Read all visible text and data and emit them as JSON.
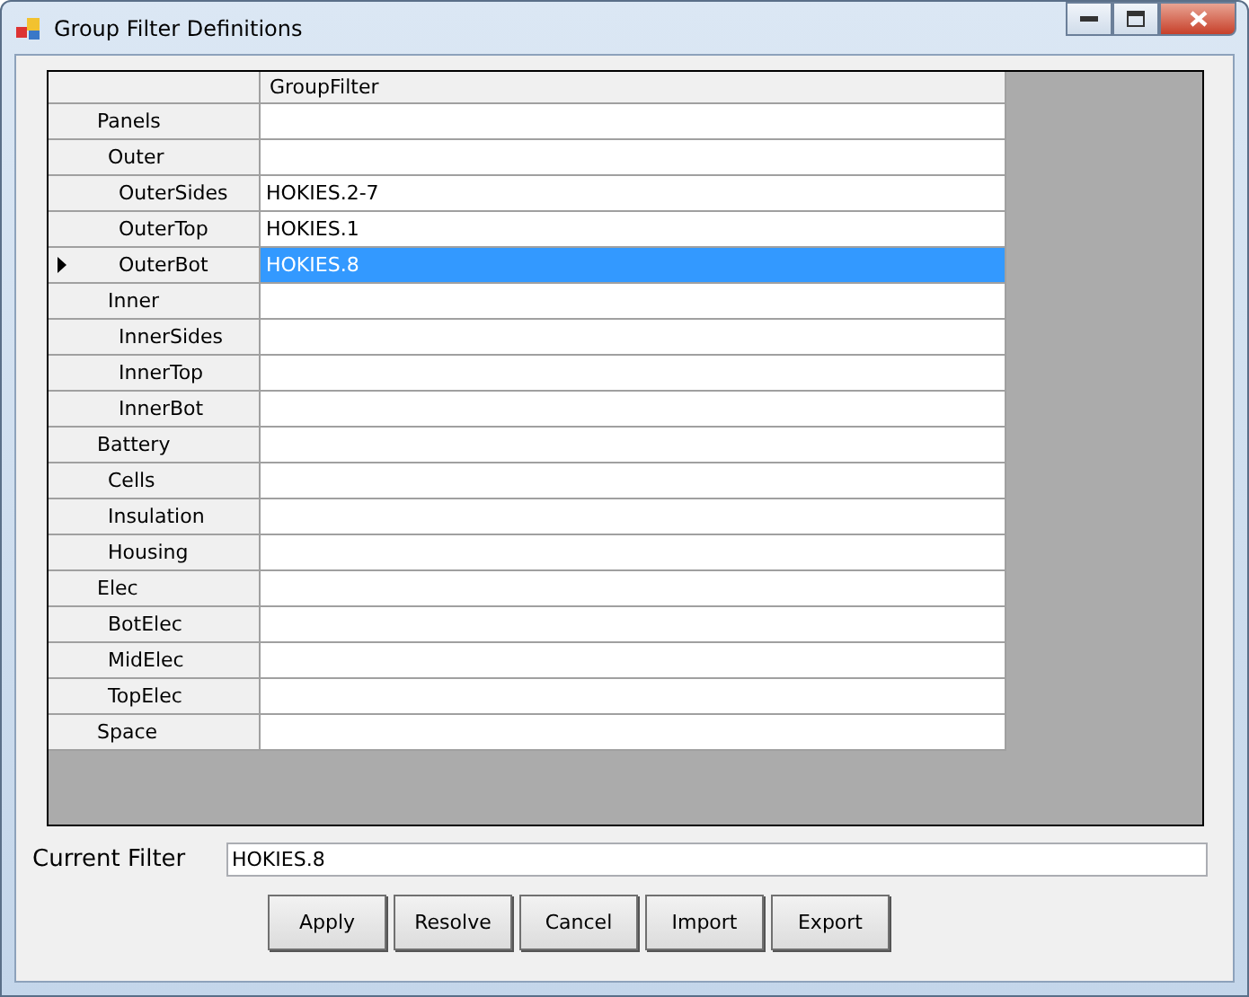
{
  "window": {
    "title": "Group Filter Definitions"
  },
  "grid": {
    "columns": [
      "GroupFilter"
    ],
    "rows": [
      {
        "label": "Panels",
        "selected": false,
        "children": [
          {
            "label": "Outer",
            "selected": false,
            "children": [
              {
                "label": "OuterSides",
                "value": "HOKIES.2-7",
                "selected": false
              },
              {
                "label": "OuterTop",
                "value": "HOKIES.1",
                "selected": false
              },
              {
                "label": "OuterBot",
                "value": "HOKIES.8",
                "selected": true
              }
            ]
          },
          {
            "label": "Inner",
            "selected": false,
            "children": [
              {
                "label": "InnerSides",
                "selected": false
              },
              {
                "label": "InnerTop",
                "selected": false
              },
              {
                "label": "InnerBot",
                "selected": false
              }
            ]
          }
        ]
      },
      {
        "label": "Battery",
        "selected": false,
        "children": [
          {
            "label": "Cells",
            "selected": false
          },
          {
            "label": "Insulation",
            "selected": false
          },
          {
            "label": "Housing",
            "selected": false
          }
        ]
      },
      {
        "label": "Elec",
        "selected": false,
        "children": [
          {
            "label": "BotElec",
            "selected": false
          },
          {
            "label": "MidElec",
            "selected": false
          },
          {
            "label": "TopElec",
            "selected": false
          }
        ]
      },
      {
        "label": "Space",
        "selected": false
      }
    ]
  },
  "current_filter": {
    "label": "Current Filter",
    "value": "HOKIES.8"
  },
  "buttons": [
    "Apply",
    "Resolve",
    "Cancel",
    "Import",
    "Export"
  ]
}
